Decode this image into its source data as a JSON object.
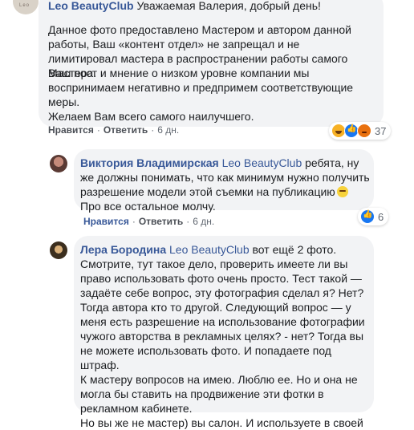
{
  "comment1": {
    "author": "Leo BeautyClub",
    "text_first": "Уважаемая Валерия, добрый день!",
    "text_p1": "Данное фото предоставлено Мастером и автором данной работы, Ваш «контент отдел» не запрещал и не лимитировал мастера в распространении работы самого Мастера.",
    "text_p2": "Ваш пост и мнение о низком уровне компании мы воспринимаем негативно и предпримем соответствующие меры.",
    "text_p3": "Желаем Вам всего самого наилучшего.",
    "like_label": "Нравится",
    "reply_label": "Ответить",
    "time": "6 дн.",
    "reactions_count": "37",
    "avatar_text": "Leo"
  },
  "comment2": {
    "author": "Виктория Владимирская",
    "mention": "Leo BeautyClub",
    "text": "ребята, ну же должны понимать, что как минимум нужно получить разрешение модели этой съемки на публикацию",
    "text_line2": "Про все остальное молчу.",
    "like_label": "Нравится",
    "reply_label": "Ответить",
    "time": "6 дн.",
    "reactions_count": "6"
  },
  "comment3": {
    "author": "Лера Бородина",
    "mention": "Leo BeautyClub",
    "text": "вот ещё 2 фото. Смотрите, тут такое дело, проверить имеете ли вы право использовать фото очень просто. Тест такой — задаёте себе вопрос, эту фотография сделал я? Нет? Тогда автора кто то другой. Следующий вопрос — у меня есть разрешение на использование фотографии чужого авторства в рекламных целях? - нет? Тогда вы не можете использовать фото. И попадаете под штраф.",
    "text_p2": "К мастеру вопросов на имею. Люблю ее. Но и она не могла бы ставить на продвижение эти фотки в рекламном кабинете.",
    "text_p3": "Но вы же не мастер) вы салон. И используете в своей"
  }
}
